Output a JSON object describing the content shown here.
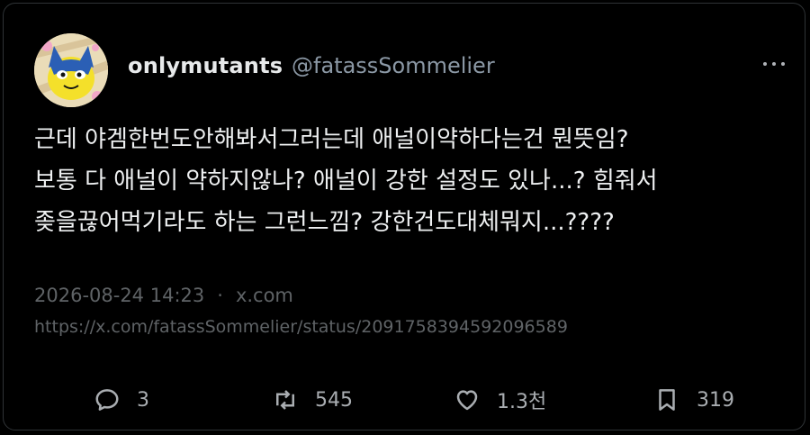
{
  "author": {
    "display_name": "onlymutants",
    "handle": "@fatassSommelier"
  },
  "tweet": {
    "lines": [
      "근데 야겜한번도안해봐서그러는데 애널이약하다는건 뭔뜻임?",
      "보통 다 애널이 약하지않나? 애널이 강한 설정도 있나...? 힘줘서",
      "좆을끊어먹기라도 하는 그런느낌? 강한건도대체뭐지...????"
    ],
    "timestamp": "2026-08-24 14:23",
    "separator": "·",
    "source": "x.com",
    "url": "https://x.com/fatassSommelier/status/2091758394592096589"
  },
  "actions": {
    "replies": "3",
    "reposts": "545",
    "likes": "1.3천",
    "bookmarks": "319"
  },
  "icons": {
    "more": "more-horizontal-icon",
    "reply": "reply-icon",
    "repost": "repost-icon",
    "like": "heart-icon",
    "bookmark": "bookmark-icon"
  },
  "colors": {
    "background": "#000000",
    "text": "#e7e9ea",
    "secondary": "#8b98a5",
    "muted": "#5f6366"
  }
}
